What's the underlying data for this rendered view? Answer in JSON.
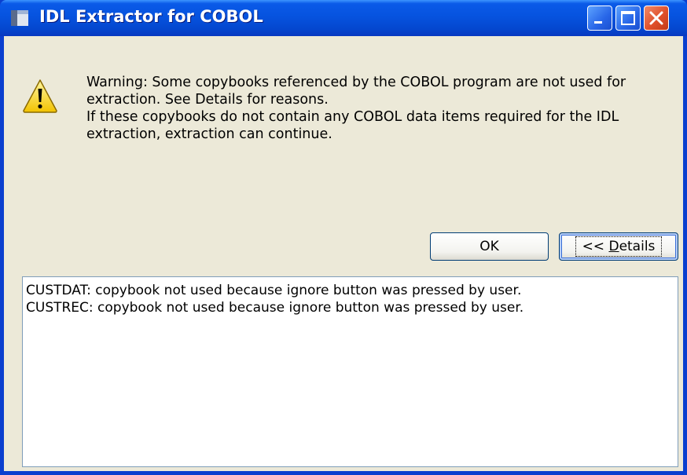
{
  "window": {
    "title": "IDL Extractor for COBOL",
    "icons": {
      "app": "app-window-icon",
      "minimize": "minimize-icon",
      "maximize": "maximize-icon",
      "close": "close-icon"
    }
  },
  "message": {
    "icon": "warning-icon",
    "line1": "Warning: Some copybooks referenced by the COBOL program are not used for extraction. See Details for reasons.",
    "line2": "If these copybooks do not contain any COBOL data items required for the IDL extraction, extraction can continue."
  },
  "buttons": {
    "ok": "OK",
    "details_prefix": "<< ",
    "details_accel": "D",
    "details_rest": "etails"
  },
  "details": {
    "lines": [
      "CUSTDAT: copybook not used because ignore button was pressed by user.",
      "CUSTREC: copybook not used because ignore button was pressed by user."
    ]
  },
  "colors": {
    "titlebar": "#0653df",
    "face": "#ece9d8",
    "close": "#e0502a"
  }
}
